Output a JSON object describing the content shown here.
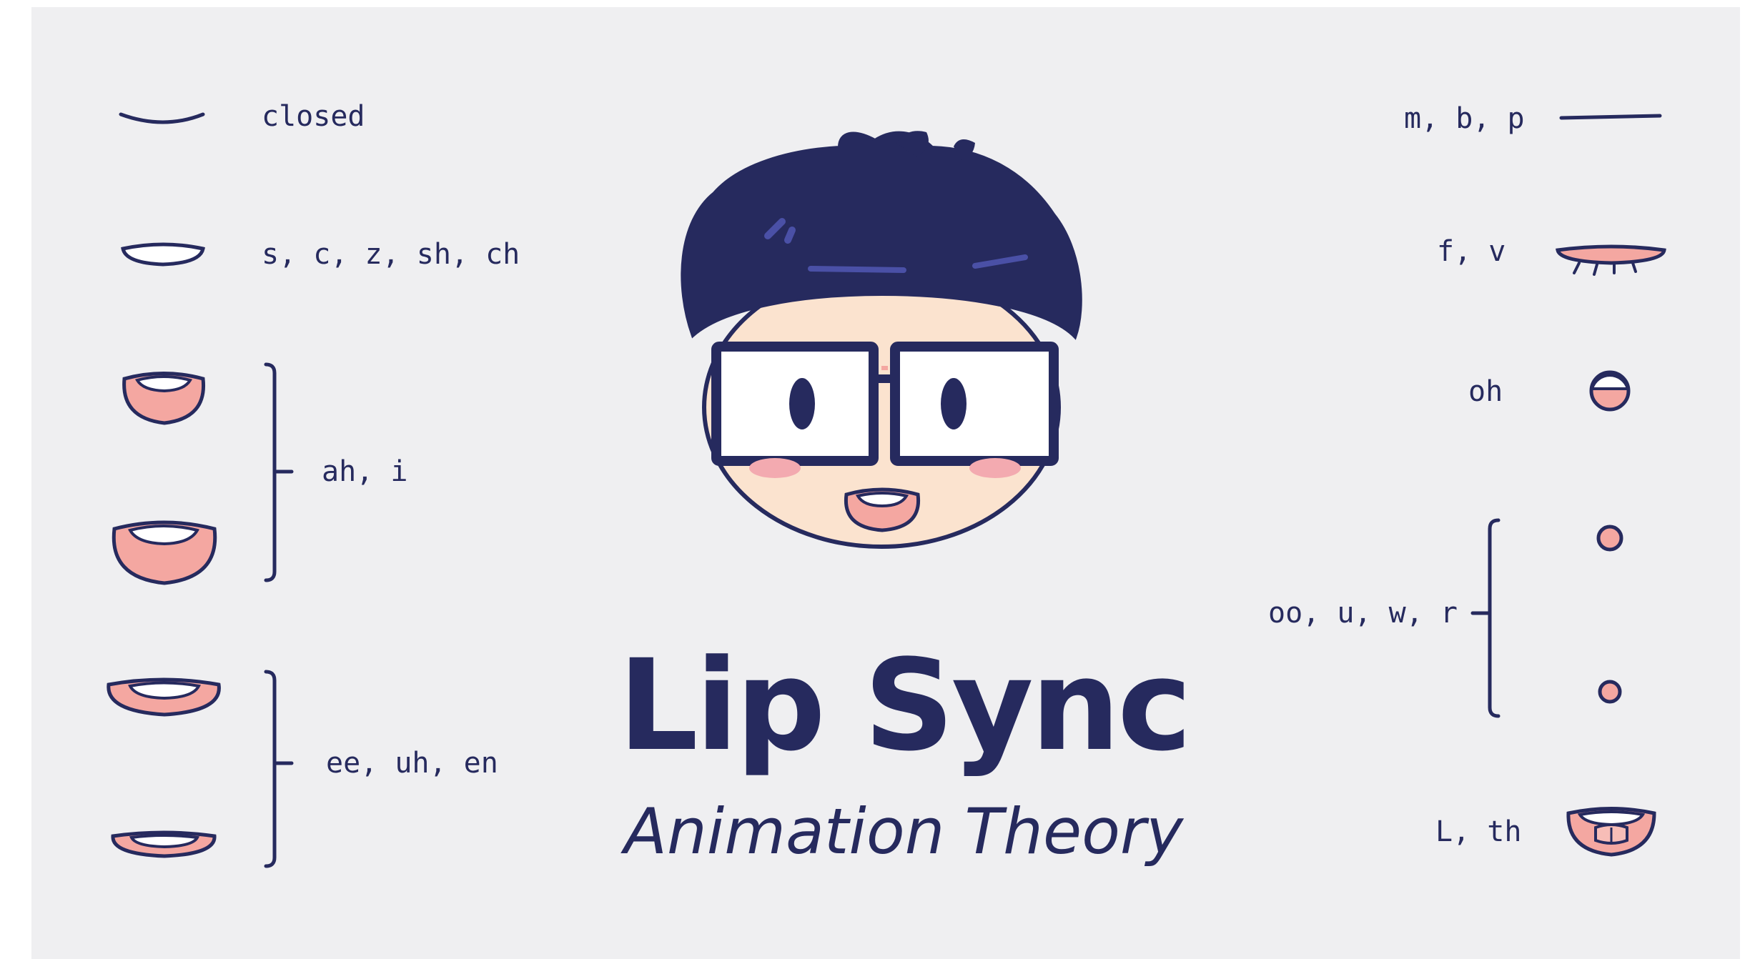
{
  "header": {
    "title": "Lip Sync",
    "subtitle": "Animation Theory"
  },
  "mouth_shapes": {
    "left": [
      {
        "label": "closed"
      },
      {
        "label": "s, c, z, sh, ch"
      },
      {
        "label": "ah, i"
      },
      {
        "label": "ee, uh, en"
      }
    ],
    "right": [
      {
        "label": "m, b, p"
      },
      {
        "label": "f, v"
      },
      {
        "label": "oh"
      },
      {
        "label": "oo, u, w, r"
      },
      {
        "label": "L, th"
      }
    ]
  },
  "colors": {
    "navy": "#262a5e",
    "pink": "#f4a7a1",
    "blush": "#f3aab0",
    "skin": "#fbe3cf",
    "background": "#efeff1",
    "white": "#ffffff"
  }
}
